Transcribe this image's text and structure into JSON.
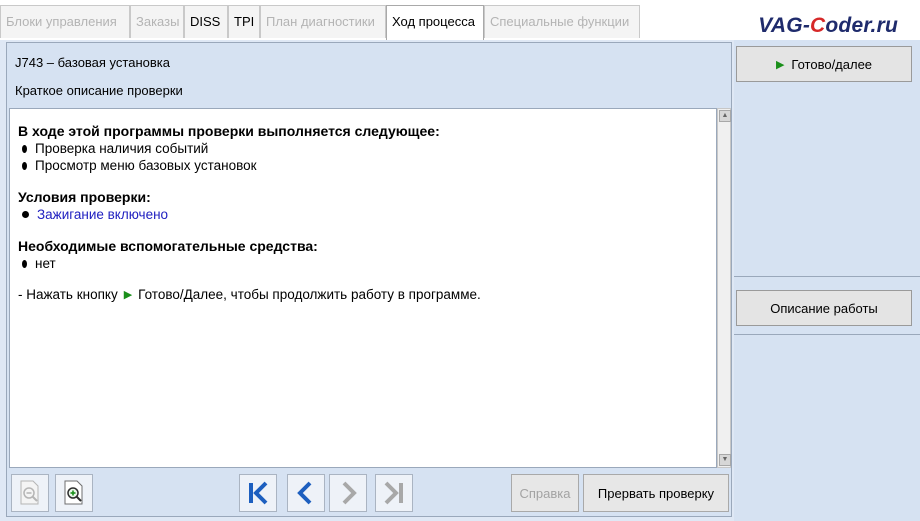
{
  "tabs": [
    {
      "label": "Блоки управления",
      "state": "disabled"
    },
    {
      "label": "Заказы",
      "state": "disabled"
    },
    {
      "label": "DISS",
      "state": "enabled"
    },
    {
      "label": "TPI",
      "state": "enabled"
    },
    {
      "label": "План диагностики",
      "state": "disabled"
    },
    {
      "label": "Ход процесса",
      "state": "active"
    },
    {
      "label": "Специальные функции",
      "state": "disabled"
    }
  ],
  "watermark": {
    "prefix": "VAG-",
    "highlight": "C",
    "suffix": "oder.ru"
  },
  "header": {
    "title": "J743 – базовая установка",
    "subtitle": "Краткое описание проверки"
  },
  "content": {
    "section1": {
      "heading": "В ходе этой программы проверки выполняется следующее:",
      "items": [
        "Проверка наличия событий",
        "Просмотр меню базовых установок"
      ]
    },
    "section2": {
      "heading": "Условия проверки:",
      "items": [
        "Зажигание включено"
      ]
    },
    "section3": {
      "heading": "Необходимые вспомогательные средства:",
      "items": [
        "нет"
      ]
    },
    "note_prefix": "- Нажать кнопку",
    "note_suffix": "Готово/Далее, чтобы продолжить работу в программе."
  },
  "toolbar": {
    "help_label": "Справка",
    "abort_label": "Прервать проверку"
  },
  "right_panel": {
    "done_label": "Готово/далее",
    "description_label": "Описание работы"
  },
  "colors": {
    "panel_bg": "#d6e2f2",
    "accent_green": "#1a8f1a",
    "nav_blue": "#1d5fbf",
    "link_blue": "#2020c0"
  }
}
